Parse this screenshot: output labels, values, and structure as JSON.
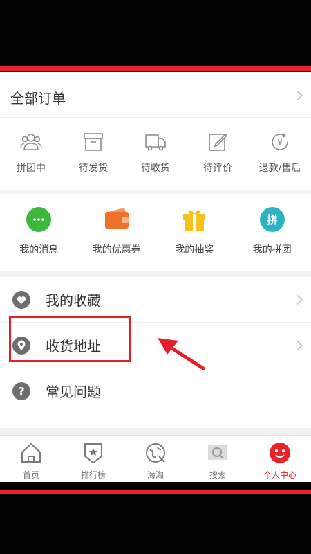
{
  "orders": {
    "title": "全部订单",
    "items": [
      {
        "label": "拼团中",
        "icon": "group-icon"
      },
      {
        "label": "待发货",
        "icon": "box-icon"
      },
      {
        "label": "待收货",
        "icon": "truck-icon"
      },
      {
        "label": "待评价",
        "icon": "edit-icon"
      },
      {
        "label": "退款/售后",
        "icon": "refund-icon"
      }
    ]
  },
  "features": {
    "items": [
      {
        "label": "我的消息",
        "icon": "message-icon",
        "color": "#3cb83a"
      },
      {
        "label": "我的优惠券",
        "icon": "coupon-icon",
        "color": "#f2712a"
      },
      {
        "label": "我的抽奖",
        "icon": "gift-icon",
        "color": "#f5c21d"
      },
      {
        "label": "我的拼团",
        "icon": "group-buy-icon",
        "color": "#2bb3c4",
        "badge": "拼"
      }
    ]
  },
  "list": {
    "items": [
      {
        "label": "我的收藏",
        "icon": "heart-icon"
      },
      {
        "label": "收货地址",
        "icon": "location-icon"
      },
      {
        "label": "常见问题",
        "icon": "question-icon",
        "glyph": "?"
      }
    ]
  },
  "tabbar": {
    "items": [
      {
        "label": "首页",
        "icon": "home-icon"
      },
      {
        "label": "排行榜",
        "icon": "rank-icon"
      },
      {
        "label": "海淘",
        "icon": "globe-icon"
      },
      {
        "label": "搜索",
        "icon": "search-icon"
      },
      {
        "label": "个人中心",
        "icon": "profile-icon",
        "active": true
      }
    ]
  },
  "colors": {
    "accent": "#e8232a",
    "icon_gray": "#6e6e6e"
  }
}
